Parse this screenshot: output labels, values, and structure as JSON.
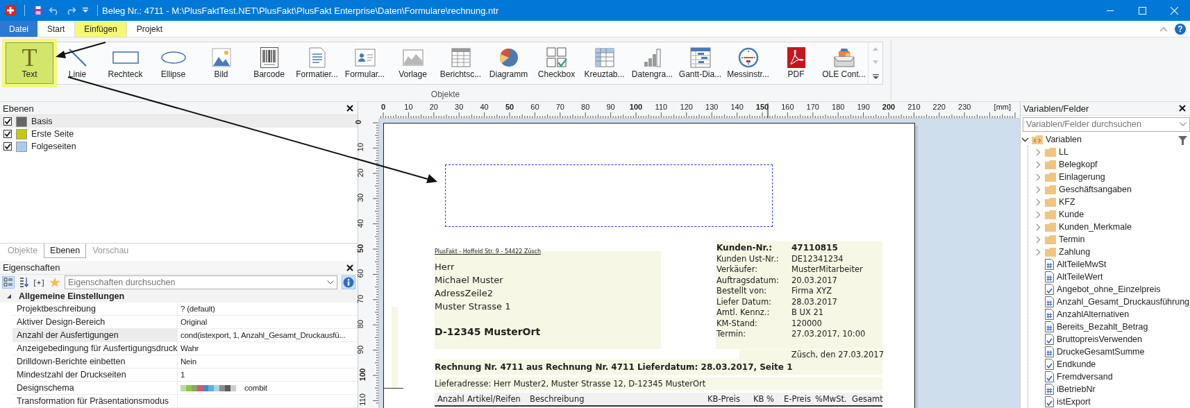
{
  "window": {
    "title": "Beleg Nr.: 4711 - M:\\PlusFaktTest.NET\\PlusFakt\\PlusFakt Enterprise\\Daten\\Formulare\\rechnung.ntr"
  },
  "menu_tabs": [
    {
      "label": "Datei",
      "kind": "file",
      "selected": false,
      "highlighted": false
    },
    {
      "label": "Start",
      "kind": "tab",
      "selected": false,
      "highlighted": false
    },
    {
      "label": "Einfügen",
      "kind": "tab",
      "selected": true,
      "highlighted": true
    },
    {
      "label": "Projekt",
      "kind": "tab",
      "selected": false,
      "highlighted": false
    }
  ],
  "ribbon": {
    "help": "?",
    "group_label": "Objekte",
    "tools": [
      {
        "label": "Text",
        "kind": "text",
        "glyph": "T",
        "selected": true,
        "highlighted": true
      },
      {
        "label": "Linie",
        "kind": "line",
        "selected": false,
        "highlighted": false
      },
      {
        "label": "Rechteck",
        "kind": "rect",
        "selected": false,
        "highlighted": false
      },
      {
        "label": "Ellipse",
        "kind": "ellipse",
        "selected": false,
        "highlighted": false
      },
      {
        "label": "Bild",
        "kind": "image",
        "selected": false,
        "highlighted": false
      },
      {
        "label": "Barcode",
        "kind": "barcode",
        "selected": false,
        "highlighted": false
      },
      {
        "label": "Formatier...",
        "kind": "doc",
        "selected": false,
        "highlighted": false
      },
      {
        "label": "Formular...",
        "kind": "form",
        "selected": false,
        "highlighted": false
      },
      {
        "label": "Vorlage",
        "kind": "template",
        "selected": false,
        "highlighted": false
      },
      {
        "label": "Berichtsc...",
        "kind": "table",
        "selected": false,
        "highlighted": false
      },
      {
        "label": "Diagramm",
        "kind": "pie",
        "selected": false,
        "highlighted": false
      },
      {
        "label": "Checkbox",
        "kind": "checkbox",
        "selected": false,
        "highlighted": false
      },
      {
        "label": "Kreuztab...",
        "kind": "crosstab",
        "selected": false,
        "highlighted": false
      },
      {
        "label": "Datengra...",
        "kind": "bars",
        "selected": false,
        "highlighted": false
      },
      {
        "label": "Gantt-Dia...",
        "kind": "gantt",
        "selected": false,
        "highlighted": false
      },
      {
        "label": "Messinstr...",
        "kind": "gauge",
        "selected": false,
        "highlighted": false
      },
      {
        "label": "PDF",
        "kind": "pdf",
        "selected": false,
        "highlighted": false
      },
      {
        "label": "OLE Cont...",
        "kind": "ole",
        "selected": false,
        "highlighted": false
      }
    ]
  },
  "layers_panel": {
    "title": "Ebenen",
    "layers": [
      {
        "name": "Basis",
        "checked": true,
        "color": "#666666",
        "selected": true
      },
      {
        "name": "Erste Seite",
        "checked": true,
        "color": "#c4cc00",
        "selected": false
      },
      {
        "name": "Folgeseiten",
        "checked": true,
        "color": "#a8cbf0",
        "selected": false
      }
    ]
  },
  "left_tabs": [
    {
      "label": "Objekte",
      "selected": false,
      "disabled": true
    },
    {
      "label": "Ebenen",
      "selected": true,
      "disabled": false
    },
    {
      "label": "Vorschau",
      "selected": false,
      "disabled": true
    }
  ],
  "properties_panel": {
    "title": "Eigenschaften",
    "expand_label": "[+]",
    "search": {
      "placeholder": "Eigenschaften durchsuchen"
    },
    "group": {
      "label": "Allgemeine Einstellungen",
      "expanded": true
    },
    "rows": [
      {
        "name": "Projektbeschreibung",
        "value": "? (default)",
        "selected": false
      },
      {
        "name": "Aktiver Design-Bereich",
        "value": "Original",
        "selected": false
      },
      {
        "name": "Anzahl der Ausfertigungen",
        "value": "cond(istexport, 1, Anzahl_Gesamt_Druckausfü...",
        "selected": true
      },
      {
        "name": "Anzeigebedingung für Ausfertigungsdruck",
        "value": "Wahr",
        "selected": false
      },
      {
        "name": "Drilldown-Berichte einbetten",
        "value": "Nein",
        "selected": false
      },
      {
        "name": "Mindestzahl der Druckseiten",
        "value": "1",
        "selected": false
      },
      {
        "name": "Designschema",
        "value": "combit",
        "selected": false,
        "swatches": [
          {
            "color": "#b7dca0"
          },
          {
            "color": "#8dc63f"
          },
          {
            "color": "#8aa66b"
          },
          {
            "color": "#e0526e"
          },
          {
            "color": "#3f8fbf"
          },
          {
            "color": "#5cb4d6"
          },
          {
            "color": "#a9d4e0"
          },
          {
            "color": "#8c8c8c"
          },
          {
            "color": "#5a5a5a"
          },
          {
            "color": "#cccccc"
          }
        ]
      },
      {
        "name": "Transformation für Präsentationsmodus",
        "value": "",
        "selected": false
      }
    ]
  },
  "canvas": {
    "ruler_top": {
      "labels": [
        "0",
        "10",
        "20",
        "30",
        "40",
        "50",
        "60",
        "70",
        "80",
        "90",
        "100",
        "110",
        "120",
        "130",
        "140",
        "150",
        "160",
        "170",
        "180",
        "190",
        "200",
        "210",
        "220",
        "230"
      ],
      "unit": "[mm]"
    },
    "ruler_left": {
      "labels": [
        "0",
        "10",
        "20",
        "30",
        "40",
        "50",
        "60",
        "70",
        "80",
        "90",
        "100",
        "110"
      ]
    },
    "page": {
      "sender_line": "PlusFakt - Hoffeld Str. 9 - 54422 Züsch",
      "address_lines": [
        "Herr",
        "Michael Muster",
        "AdressZeile2",
        "Muster Strasse 1"
      ],
      "city_line": "D-12345 MusterOrt",
      "info_rows": [
        {
          "label": "Kunden-Nr.:",
          "value": "47110815",
          "emphasized": true
        },
        {
          "label": "Kunden Ust-Nr.:",
          "value": "DE12341234",
          "emphasized": false
        },
        {
          "label": "Verkäufer:",
          "value": "MusterMitarbeiter",
          "emphasized": false
        },
        {
          "label": "Auftragsdatum:",
          "value": "20.03.2017",
          "emphasized": false
        },
        {
          "label": "Bestellt von:",
          "value": "Firma XYZ",
          "emphasized": false
        },
        {
          "label": "Liefer Datum:",
          "value": "28.03.2017",
          "emphasized": false
        },
        {
          "label": "Amtl. Kennz.:",
          "value": "B UX 21",
          "emphasized": false
        },
        {
          "label": "KM-Stand:",
          "value": "120000",
          "emphasized": false
        },
        {
          "label": "Termin:",
          "value": "27.03.2017, 10:00",
          "emphasized": false
        }
      ],
      "date_line": "Züsch, den 27.03.2017",
      "invoice_title": "Rechnung Nr. 4711 aus Rechnung Nr. 4711 Lieferdatum: 28.03.2017, Seite 1",
      "delivery_address": "Lieferadresse: Herr Muster2, Muster Strasse 12, D-12345 MusterOrt",
      "table_columns": [
        "Anzahl",
        "Artikel/Reifen",
        "Beschreibung",
        "KB-Preis",
        "KB %",
        "E-Preis",
        "%MwSt.",
        "Gesamt"
      ]
    }
  },
  "variables_panel": {
    "title": "Variablen/Felder",
    "search": {
      "placeholder": "Variablen/Felder durchsuchen"
    },
    "tree": [
      {
        "label": "Variablen",
        "kind": "root",
        "expanded": true,
        "children": [
          {
            "label": "LL",
            "kind": "folder",
            "expanded": false
          },
          {
            "label": "Belegkopf",
            "kind": "folder",
            "expanded": false
          },
          {
            "label": "Einlagerung",
            "kind": "folder",
            "expanded": false
          },
          {
            "label": "Geschäftsangaben",
            "kind": "folder",
            "expanded": false
          },
          {
            "label": "KFZ",
            "kind": "folder",
            "expanded": false
          },
          {
            "label": "Kunde",
            "kind": "folder",
            "expanded": false
          },
          {
            "label": "Kunden_Merkmale",
            "kind": "folder",
            "expanded": false
          },
          {
            "label": "Termin",
            "kind": "folder",
            "expanded": false
          },
          {
            "label": "Zahlung",
            "kind": "folder",
            "expanded": false
          },
          {
            "label": "AltTeileMwSt",
            "kind": "number"
          },
          {
            "label": "AltTeileWert",
            "kind": "number"
          },
          {
            "label": "Angebot_ohne_Einzelpreis",
            "kind": "bool"
          },
          {
            "label": "Anzahl_Gesamt_Druckausführung",
            "kind": "number"
          },
          {
            "label": "AnzahlAlternativen",
            "kind": "number"
          },
          {
            "label": "Bereits_Bezahlt_Betrag",
            "kind": "number"
          },
          {
            "label": "BruttopreisVerwenden",
            "kind": "bool"
          },
          {
            "label": "DruckeGesamtSumme",
            "kind": "number"
          },
          {
            "label": "Endkunde",
            "kind": "bool"
          },
          {
            "label": "Fremdversand",
            "kind": "bool"
          },
          {
            "label": "iBetriebNr",
            "kind": "number"
          },
          {
            "label": "istExport",
            "kind": "bool"
          }
        ]
      }
    ]
  }
}
